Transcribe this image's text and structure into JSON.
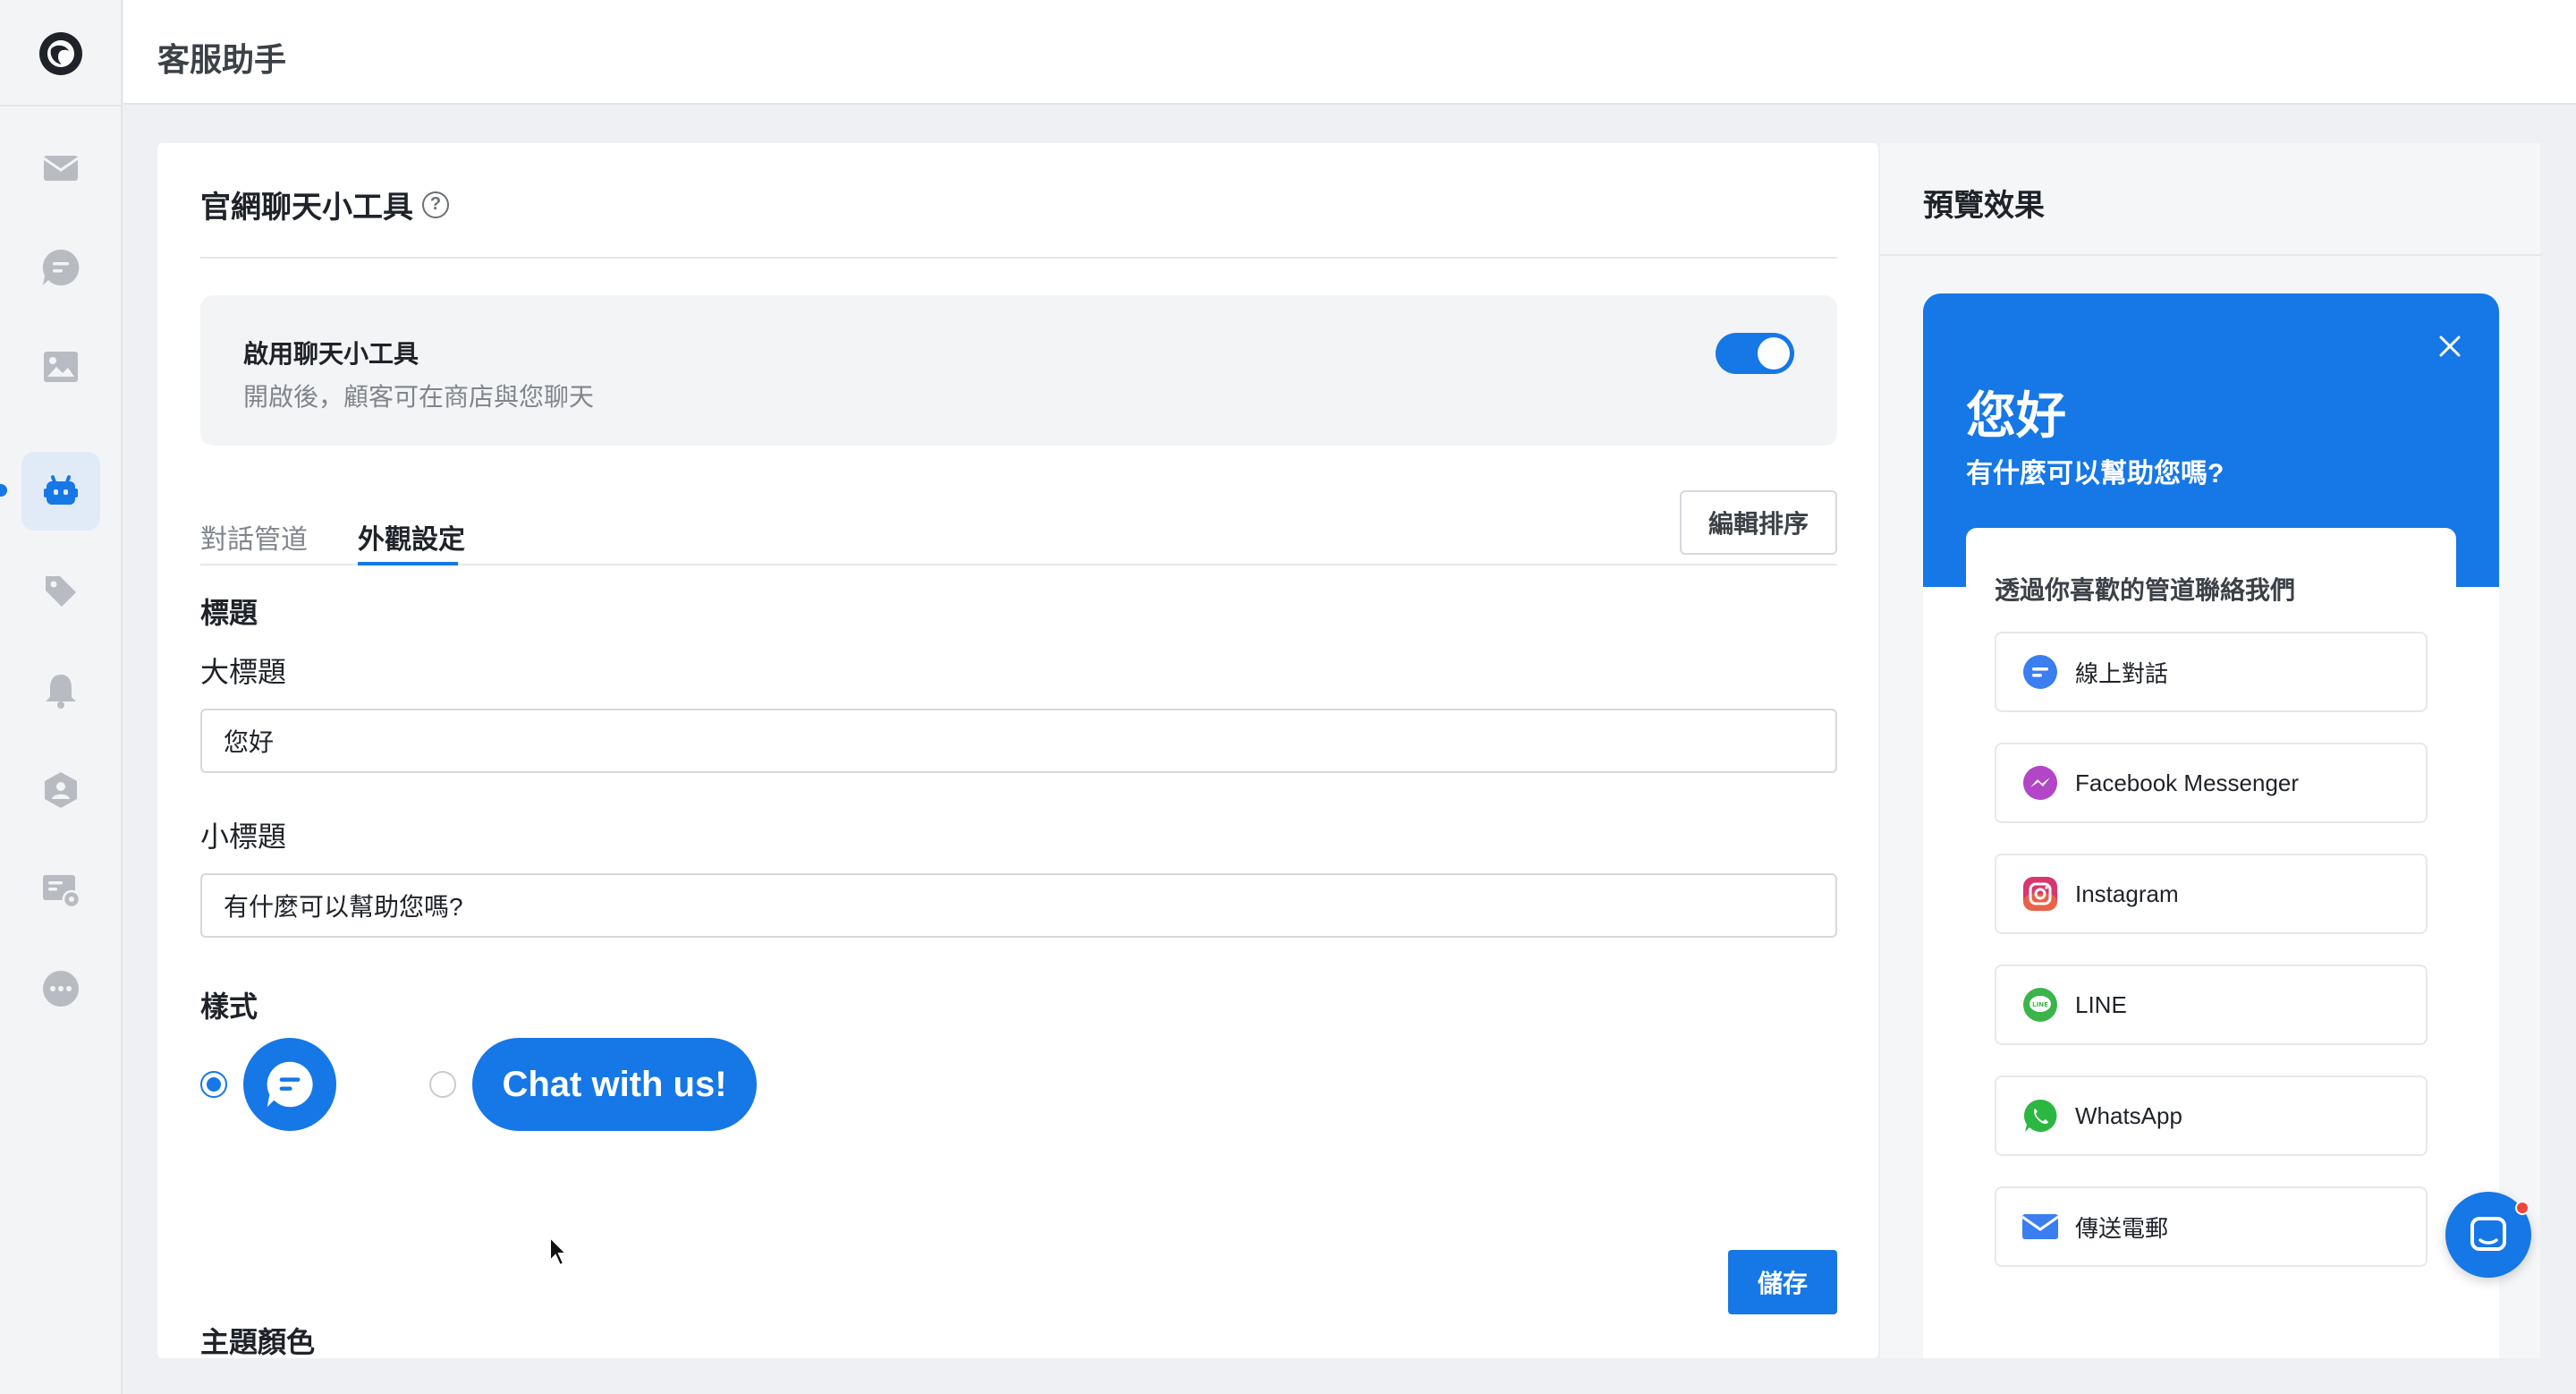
{
  "app": {
    "title": "客服助手"
  },
  "sidebar": {
    "items": [
      {
        "name": "inbox"
      },
      {
        "name": "chat"
      },
      {
        "name": "media"
      },
      {
        "name": "bot",
        "active": true
      },
      {
        "name": "tags"
      },
      {
        "name": "notifications"
      },
      {
        "name": "team"
      },
      {
        "name": "channel-settings"
      },
      {
        "name": "more"
      }
    ]
  },
  "settings": {
    "title": "官網聊天小工具",
    "enable": {
      "title": "啟用聊天小工具",
      "description": "開啟後，顧客可在商店與您聊天",
      "on": true
    },
    "tabs": [
      {
        "label": "對話管道"
      },
      {
        "label": "外觀設定",
        "active": true
      }
    ],
    "edit_order_label": "編輯排序",
    "heading_section_label": "標題",
    "main_title_label": "大標題",
    "main_title_value": "您好",
    "subtitle_label": "小標題",
    "subtitle_value": "有什麼可以幫助您嗎?",
    "style_label": "樣式",
    "style_text_button": "Chat with us!",
    "theme_color_label": "主題顏色",
    "save_label": "儲存"
  },
  "preview": {
    "title": "預覽效果",
    "widget": {
      "heading": "您好",
      "subheading": "有什麼可以幫助您嗎?",
      "card_title": "透過你喜歡的管道聯絡我們",
      "channels": [
        {
          "label": "線上對話",
          "icon": "chat-icon"
        },
        {
          "label": "Facebook Messenger",
          "icon": "messenger-icon"
        },
        {
          "label": "Instagram",
          "icon": "instagram-icon"
        },
        {
          "label": "LINE",
          "icon": "line-icon"
        },
        {
          "label": "WhatsApp",
          "icon": "whatsapp-icon"
        },
        {
          "label": "傳送電郵",
          "icon": "email-icon"
        }
      ]
    }
  },
  "colors": {
    "accent": "#1677e6",
    "sidebar_icon": "#b8bcc2",
    "text": "#1f2329"
  }
}
